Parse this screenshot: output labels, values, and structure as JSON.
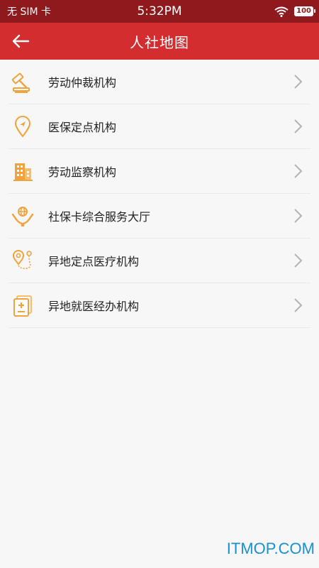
{
  "status_bar": {
    "carrier": "无 SIM 卡",
    "time": "5:32PM",
    "battery": "100"
  },
  "app_bar": {
    "title": "人社地图"
  },
  "menu": {
    "items": [
      {
        "label": "劳动仲裁机构",
        "icon": "gavel-icon"
      },
      {
        "label": "医保定点机构",
        "icon": "location-pin-icon"
      },
      {
        "label": "劳动监察机构",
        "icon": "building-icon"
      },
      {
        "label": "社保卡综合服务大厅",
        "icon": "hands-globe-icon"
      },
      {
        "label": "异地定点医疗机构",
        "icon": "route-pin-icon"
      },
      {
        "label": "异地就医经办机构",
        "icon": "medical-document-icon"
      }
    ]
  },
  "watermark": "ITMOP.COM",
  "colors": {
    "status_bar": "#8f1a1d",
    "app_bar": "#d32d30",
    "icon_accent": "#f0a33c",
    "background": "#f7f7f7"
  }
}
